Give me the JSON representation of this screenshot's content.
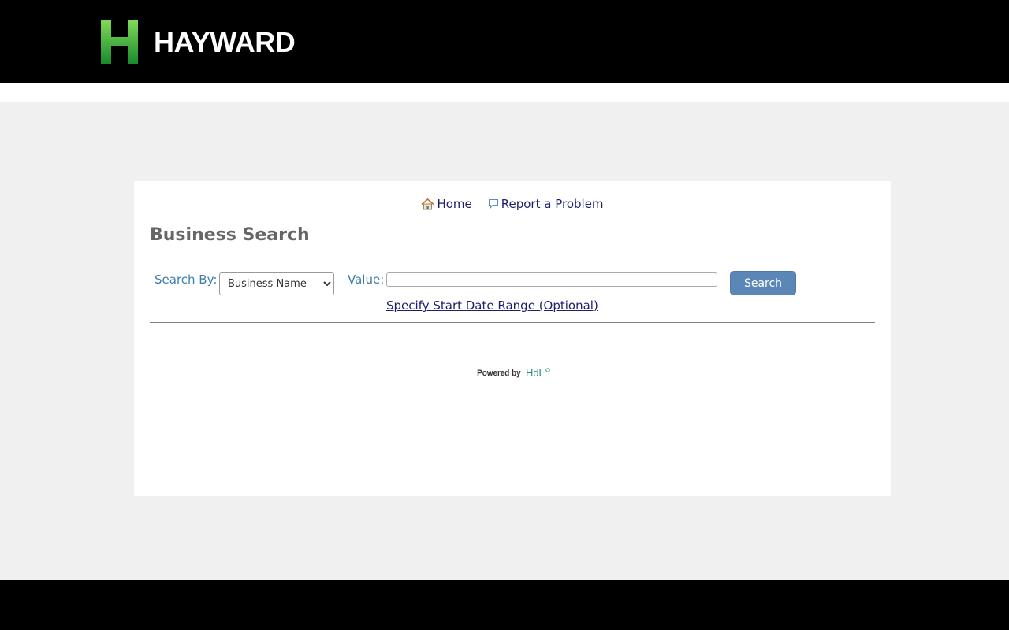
{
  "header": {
    "logo_text": "HAYWARD",
    "brand_green": "#3aa83a"
  },
  "nav": {
    "home_label": "Home",
    "report_label": "Report a Problem"
  },
  "page": {
    "title": "Business Search"
  },
  "search": {
    "search_by_label": "Search By:",
    "selected_option": "Business Name",
    "value_label": "Value:",
    "value": "",
    "button_label": "Search",
    "date_range_link": "Specify Start Date Range (Optional)"
  },
  "footer_branding": {
    "powered_by": "Powered by",
    "brand": "HdL"
  },
  "colors": {
    "label_blue": "#3b7eb0",
    "link_navy": "#1f1f6e",
    "button_blue": "#5b87b8"
  }
}
